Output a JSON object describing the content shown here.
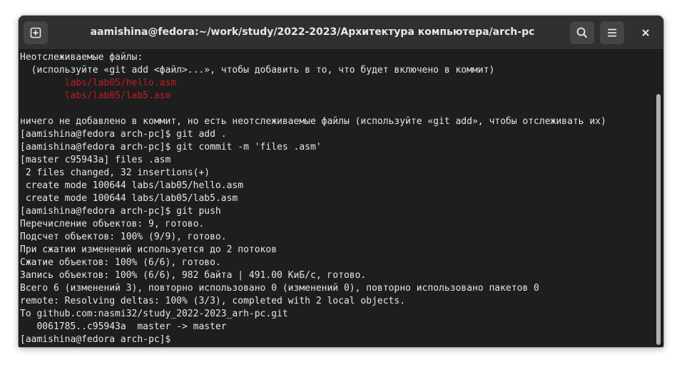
{
  "window": {
    "title": "aamishina@fedora:~/work/study/2022-2023/Архитектура компьютера/arch-pc"
  },
  "icons": {
    "new_tab": "new-tab-icon",
    "search": "search-icon",
    "menu": "hamburger-menu-icon",
    "close": "close-icon"
  },
  "terminal": {
    "lines": [
      {
        "text": "Неотслеживаемые файлы:",
        "style": "normal"
      },
      {
        "text": "  (используйте «git add <файл>...», чтобы добавить в то, что будет включено в коммит)",
        "style": "normal"
      },
      {
        "text": "        labs/lab05/hello.asm",
        "style": "red"
      },
      {
        "text": "        labs/lab05/lab5.asm",
        "style": "red"
      },
      {
        "text": "",
        "style": "normal"
      },
      {
        "text": "ничего не добавлено в коммит, но есть неотслеживаемые файлы (используйте «git add», чтобы отслеживать их)",
        "style": "normal"
      },
      {
        "text": "[aamishina@fedora arch-pc]$ git add .",
        "style": "normal"
      },
      {
        "text": "[aamishina@fedora arch-pc]$ git commit -m 'files .asm'",
        "style": "normal"
      },
      {
        "text": "[master c95943a] files .asm",
        "style": "normal"
      },
      {
        "text": " 2 files changed, 32 insertions(+)",
        "style": "normal"
      },
      {
        "text": " create mode 100644 labs/lab05/hello.asm",
        "style": "normal"
      },
      {
        "text": " create mode 100644 labs/lab05/lab5.asm",
        "style": "normal"
      },
      {
        "text": "[aamishina@fedora arch-pc]$ git push",
        "style": "normal"
      },
      {
        "text": "Перечисление объектов: 9, готово.",
        "style": "normal"
      },
      {
        "text": "Подсчет объектов: 100% (9/9), готово.",
        "style": "normal"
      },
      {
        "text": "При сжатии изменений используется до 2 потоков",
        "style": "normal"
      },
      {
        "text": "Сжатие объектов: 100% (6/6), готово.",
        "style": "normal"
      },
      {
        "text": "Запись объектов: 100% (6/6), 982 байта | 491.00 КиБ/с, готово.",
        "style": "normal"
      },
      {
        "text": "Всего 6 (изменений 3), повторно использовано 0 (изменений 0), повторно использовано пакетов 0",
        "style": "normal"
      },
      {
        "text": "remote: Resolving deltas: 100% (3/3), completed with 2 local objects.",
        "style": "normal"
      },
      {
        "text": "To github.com:nasmi32/study_2022-2023_arh-pc.git",
        "style": "normal"
      },
      {
        "text": "   0061785..c95943a  master -> master",
        "style": "normal"
      },
      {
        "text": "[aamishina@fedora arch-pc]$ ",
        "style": "normal"
      }
    ]
  },
  "colors": {
    "background": "#1e1e1e",
    "titlebar": "#303030",
    "text": "#e6e6e6",
    "untracked": "#c01c28"
  }
}
